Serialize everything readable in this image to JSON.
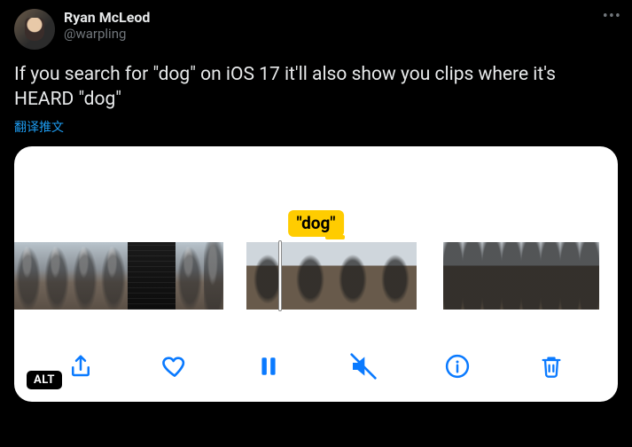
{
  "tweet": {
    "author": {
      "display_name": "Ryan McLeod",
      "handle": "@warpling"
    },
    "body": "If you search for \"dog\" on iOS 17 it'll also show you clips where it's HEARD \"dog\"",
    "translate_label": "翻译推文",
    "alt_badge": "ALT"
  },
  "media": {
    "caption_label": "\"dog\"",
    "toolbar": {
      "share": "share",
      "like": "like",
      "pause": "pause",
      "mute": "mute",
      "info": "info",
      "delete": "delete"
    }
  }
}
